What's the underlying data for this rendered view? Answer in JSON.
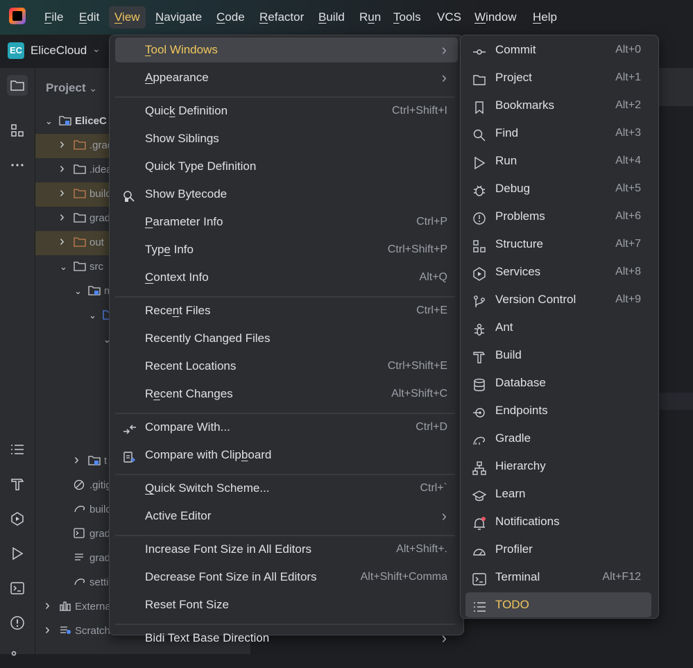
{
  "menubar": {
    "items": [
      "File",
      "Edit",
      "View",
      "Navigate",
      "Code",
      "Refactor",
      "Build",
      "Run",
      "Tools",
      "VCS",
      "Window",
      "Help"
    ],
    "active": "View"
  },
  "project": {
    "badge": "EC",
    "name": "EliceCloud",
    "panel_title": "Project"
  },
  "tree": [
    {
      "label": "EliceC",
      "indent": 0,
      "open": true,
      "hl": false,
      "type": "module"
    },
    {
      "label": ".grad",
      "indent": 1,
      "open": false,
      "hl": true,
      "type": "folder-orange"
    },
    {
      "label": ".idea",
      "indent": 1,
      "open": false,
      "hl": false,
      "type": "folder"
    },
    {
      "label": "build",
      "indent": 1,
      "open": false,
      "hl": true,
      "type": "folder-orange"
    },
    {
      "label": "gradl",
      "indent": 1,
      "open": false,
      "hl": false,
      "type": "folder"
    },
    {
      "label": "out",
      "indent": 1,
      "open": false,
      "hl": true,
      "type": "folder-orange"
    },
    {
      "label": "src",
      "indent": 1,
      "open": true,
      "hl": false,
      "type": "folder"
    },
    {
      "label": "m",
      "indent": 2,
      "open": true,
      "hl": false,
      "type": "module"
    },
    {
      "label": "",
      "indent": 3,
      "open": true,
      "hl": false,
      "type": "folder-blue"
    },
    {
      "label": "",
      "indent": 4,
      "open": true,
      "hl": false,
      "type": "none"
    },
    {
      "label": "",
      "indent": 5,
      "open": false,
      "hl": false,
      "type": "none"
    },
    {
      "label": "",
      "indent": 5,
      "open": false,
      "hl": false,
      "type": "none"
    },
    {
      "label": "",
      "indent": 5,
      "open": false,
      "hl": false,
      "type": "none"
    },
    {
      "label": "",
      "indent": 4,
      "open": false,
      "hl": false,
      "type": "file"
    },
    {
      "label": "t",
      "indent": 2,
      "open": false,
      "hl": false,
      "type": "module"
    },
    {
      "label": ".gitig",
      "indent": 1,
      "open": false,
      "hl": false,
      "type": "ignore"
    },
    {
      "label": "build",
      "indent": 1,
      "open": false,
      "hl": false,
      "type": "gradle"
    },
    {
      "label": "grad",
      "indent": 1,
      "open": false,
      "hl": false,
      "type": "terminal"
    },
    {
      "label": "grad",
      "indent": 1,
      "open": false,
      "hl": false,
      "type": "lines"
    },
    {
      "label": "setti",
      "indent": 1,
      "open": false,
      "hl": false,
      "type": "gradle"
    },
    {
      "label": "Externa",
      "indent": 0,
      "open": false,
      "hl": false,
      "type": "lib"
    },
    {
      "label": "Scratche",
      "indent": 0,
      "open": false,
      "hl": false,
      "type": "scratch"
    }
  ],
  "view_menu": [
    {
      "label": "Tool Windows",
      "shortcut": "",
      "submenu": true,
      "selected": true,
      "ul": "T"
    },
    {
      "label": "Appearance",
      "shortcut": "",
      "submenu": true,
      "ul": "A"
    },
    {
      "sep": true
    },
    {
      "label": "Quick Definition",
      "shortcut": "Ctrl+Shift+I",
      "ul": "k"
    },
    {
      "label": "Show Siblings",
      "shortcut": ""
    },
    {
      "label": "Quick Type Definition",
      "shortcut": ""
    },
    {
      "label": "Show Bytecode",
      "shortcut": "",
      "icon": "bytecode-icon"
    },
    {
      "label": "Parameter Info",
      "shortcut": "Ctrl+P",
      "ul": "P"
    },
    {
      "label": "Type Info",
      "shortcut": "Ctrl+Shift+P",
      "ul": "e"
    },
    {
      "label": "Context Info",
      "shortcut": "Alt+Q",
      "ul": "C"
    },
    {
      "sep": true
    },
    {
      "label": "Recent Files",
      "shortcut": "Ctrl+E",
      "ul": "n"
    },
    {
      "label": "Recently Changed Files",
      "shortcut": ""
    },
    {
      "label": "Recent Locations",
      "shortcut": "Ctrl+Shift+E"
    },
    {
      "label": "Recent Changes",
      "shortcut": "Alt+Shift+C",
      "ul": "e"
    },
    {
      "sep": true
    },
    {
      "label": "Compare With...",
      "shortcut": "Ctrl+D",
      "icon": "compare-icon"
    },
    {
      "label": "Compare with Clipboard",
      "shortcut": "",
      "icon": "clipboard-icon",
      "ul": "b"
    },
    {
      "sep": true
    },
    {
      "label": "Quick Switch Scheme...",
      "shortcut": "Ctrl+`",
      "ul": "Q"
    },
    {
      "label": "Active Editor",
      "shortcut": "",
      "submenu": true
    },
    {
      "sep": true
    },
    {
      "label": "Increase Font Size in All Editors",
      "shortcut": "Alt+Shift+."
    },
    {
      "label": "Decrease Font Size in All Editors",
      "shortcut": "Alt+Shift+Comma"
    },
    {
      "label": "Reset Font Size",
      "shortcut": ""
    },
    {
      "sep": true
    },
    {
      "label": "Bidi Text Base Direction",
      "shortcut": "",
      "submenu": true
    }
  ],
  "tool_windows": [
    {
      "label": "Commit",
      "shortcut": "Alt+0",
      "icon": "commit-icon"
    },
    {
      "label": "Project",
      "shortcut": "Alt+1",
      "icon": "folder-icon"
    },
    {
      "label": "Bookmarks",
      "shortcut": "Alt+2",
      "icon": "bookmark-icon"
    },
    {
      "label": "Find",
      "shortcut": "Alt+3",
      "icon": "search-icon"
    },
    {
      "label": "Run",
      "shortcut": "Alt+4",
      "icon": "run-icon"
    },
    {
      "label": "Debug",
      "shortcut": "Alt+5",
      "icon": "debug-icon"
    },
    {
      "label": "Problems",
      "shortcut": "Alt+6",
      "icon": "problems-icon"
    },
    {
      "label": "Structure",
      "shortcut": "Alt+7",
      "icon": "structure-icon"
    },
    {
      "label": "Services",
      "shortcut": "Alt+8",
      "icon": "services-icon"
    },
    {
      "label": "Version Control",
      "shortcut": "Alt+9",
      "icon": "vcs-icon"
    },
    {
      "label": "Ant",
      "shortcut": "",
      "icon": "ant-icon"
    },
    {
      "label": "Build",
      "shortcut": "",
      "icon": "hammer-icon"
    },
    {
      "label": "Database",
      "shortcut": "",
      "icon": "database-icon"
    },
    {
      "label": "Endpoints",
      "shortcut": "",
      "icon": "endpoints-icon"
    },
    {
      "label": "Gradle",
      "shortcut": "",
      "icon": "gradle-icon"
    },
    {
      "label": "Hierarchy",
      "shortcut": "",
      "icon": "hierarchy-icon"
    },
    {
      "label": "Learn",
      "shortcut": "",
      "icon": "learn-icon"
    },
    {
      "label": "Notifications",
      "shortcut": "",
      "icon": "notifications-icon"
    },
    {
      "label": "Profiler",
      "shortcut": "",
      "icon": "profiler-icon"
    },
    {
      "label": "Terminal",
      "shortcut": "Alt+F12",
      "icon": "terminal-icon"
    },
    {
      "label": "TODO",
      "shortcut": "",
      "icon": "todo-icon",
      "selected": true
    }
  ],
  "colors": {
    "accent": "#f0c75e",
    "menu_bg": "#2b2d30",
    "selected_bg": "#43454a"
  }
}
